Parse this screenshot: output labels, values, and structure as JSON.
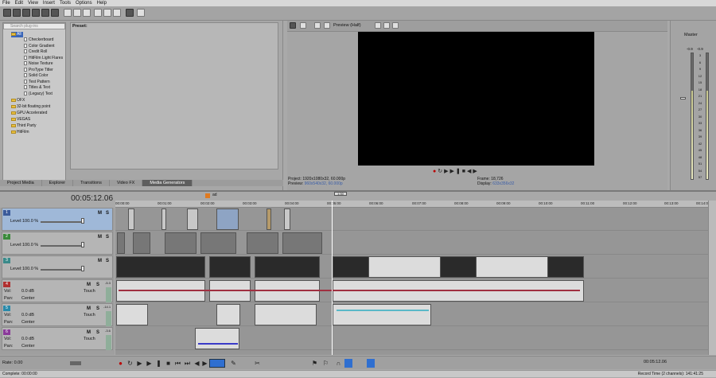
{
  "menu": [
    "File",
    "Edit",
    "View",
    "Insert",
    "Tools",
    "Options",
    "Help"
  ],
  "explorer": {
    "search_placeholder": "Search plug-ins",
    "root_label": "All",
    "generators": [
      "Checkerboard",
      "Color Gradient",
      "Credit Roll",
      "HitFilm Light Flares",
      "Noise Texture",
      "ProType Titler",
      "Solid Color",
      "Test Pattern",
      "Titles & Text",
      "(Legacy) Text"
    ],
    "folders": [
      "OFX",
      "32-bit floating point",
      "GPU Accelerated",
      "VEGAS",
      "Third Party",
      "HitFilm"
    ],
    "preset_label": "Preset:"
  },
  "tabs": [
    {
      "label": "Project Media",
      "active": false
    },
    {
      "label": "Explorer",
      "active": false
    },
    {
      "label": "Transitions",
      "active": false
    },
    {
      "label": "Video FX",
      "active": false
    },
    {
      "label": "Media Generators",
      "active": true
    }
  ],
  "preview": {
    "mode": "Preview (Half)",
    "project_label": "Project:",
    "project_value": "1920x1080x32, 60.000p",
    "preview_label": "Preview:",
    "preview_value": "960x540x32, 60.000p",
    "frame_label": "Frame:",
    "frame_value": "18,726",
    "display_label": "Display:",
    "display_value": "633x356x32"
  },
  "master": {
    "label": "Master",
    "left_level": "-0.9",
    "right_level": "-0.9",
    "scale": [
      "3",
      "6",
      "9",
      "12",
      "15",
      "18",
      "21",
      "24",
      "27",
      "30",
      "33",
      "36",
      "39",
      "42",
      "45",
      "48",
      "51",
      "54",
      "57"
    ]
  },
  "timeline": {
    "timecode": "00:05:12.06",
    "marker": "ad",
    "loop_marker": "1:30",
    "ruler": [
      "00:00:00",
      "00:01:00",
      "00:02:00",
      "00:03:00",
      "00:04:00",
      "00:05:00",
      "00:06:00",
      "00:07:00",
      "00:08:00",
      "00:09:00",
      "00:10:00",
      "00:11:00",
      "00:12:00",
      "00:13:00",
      "00:14:00"
    ],
    "video_tracks": [
      {
        "number": "1",
        "level_label": "Level:",
        "level_value": "100.0 %",
        "selected": true
      },
      {
        "number": "2",
        "level_label": "Level:",
        "level_value": "100.0 %",
        "selected": false
      },
      {
        "number": "3",
        "level_label": "Level:",
        "level_value": "100.0 %",
        "selected": false
      }
    ],
    "audio_tracks": [
      {
        "number": "4",
        "vol_label": "Vol:",
        "vol_value": "0.0 dB",
        "pan_label": "Pan:",
        "pan_value": "Center",
        "mode": "Touch",
        "peak": "-5.3"
      },
      {
        "number": "5",
        "vol_label": "Vol:",
        "vol_value": "0.0 dB",
        "pan_label": "Pan:",
        "pan_value": "Center",
        "mode": "Touch",
        "peak": "-14.1"
      },
      {
        "number": "6",
        "vol_label": "Vol:",
        "vol_value": "0.0 dB",
        "pan_label": "Pan:",
        "pan_value": "Center",
        "mode": "Touch",
        "peak": "-3.6"
      }
    ],
    "rate_label": "Rate: 0.00",
    "end_time": "00:05:12.06"
  },
  "status": {
    "left": "Complete: 00:00:00",
    "right": "Record Time (2 channels): 141:41:25"
  }
}
